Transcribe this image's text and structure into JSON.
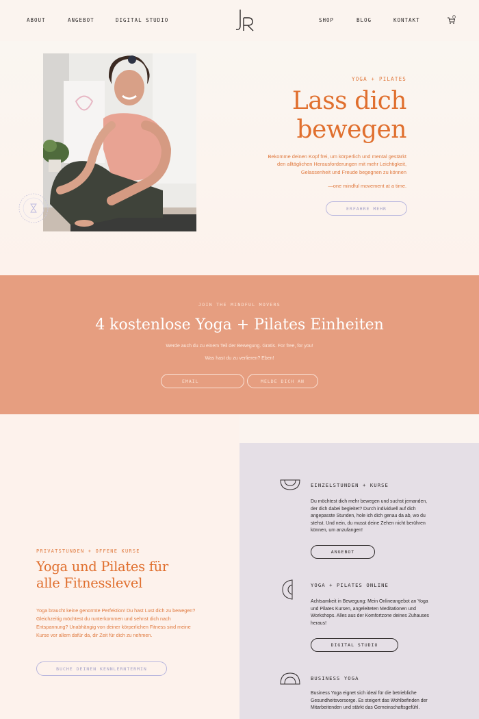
{
  "nav": {
    "left": [
      "ABOUT",
      "ANGEBOT",
      "DIGITAL STUDIO"
    ],
    "right": [
      "SHOP",
      "BLOG",
      "KONTAKT"
    ],
    "logo": "JR",
    "cart_count": "0"
  },
  "hero": {
    "eyebrow": "YOGA + PILATES",
    "title_line1": "Lass dich",
    "title_line2": "bewegen",
    "text_line1": "Bekomme deinen Kopf frei, um körperlich und mental gestärkt",
    "text_line2": "den alltäglichen Herausforderungen mit mehr Leichtigkeit,",
    "text_line3": "Gelassenheit und Freude begegnen zu können",
    "quote": "—one mindful movement at a time.",
    "button": "ERFAHRE MEHR"
  },
  "band": {
    "eyebrow": "JOIN THE MINDFUL MOVERS",
    "title": "4 kostenlose Yoga + Pilates Einheiten",
    "sub": "Werde auch du zu einem Teil der Bewegung. Gratis. For free, for you!",
    "sub2": "Was hast du zu verlieren? Eben!",
    "email_placeholder": "EMAIL",
    "button": "MELDE DICH AN"
  },
  "intro": {
    "eyebrow": "PRIVATSTUNDEN + OFFENE KURSE",
    "title_line1": "Yoga und Pilates für",
    "title_line2": "alle Fitnesslevel",
    "text": "Yoga braucht keine genormte Perfektion! Du hast Lust dich zu bewegen? Gleichzeitig möchtest du runterkommen und sehnst dich nach Entspannung? Unabhängig von deiner körperlichen Fitness sind meine Kurse vor allem dafür da, dir Zeit für dich zu nehmen.",
    "button": "BUCHE DEINEN KENNLERNTERMIN"
  },
  "services": [
    {
      "title": "EINZELSTUNDEN + KURSE",
      "text": "Du möchtest dich mehr bewegen und suchst jemanden, der dich dabei begleitet? Durch individuell auf dich angepasste Stunden, hole ich dich genau da ab, wo du stehst. Und nein, du musst deine Zehen nicht berühren können, um anzufangen!",
      "button": "ANGEBOT"
    },
    {
      "title": "YOGA + PILATES ONLINE",
      "text": "Achtsamkeit in Bewegung: Mein Onlineangebot an Yoga und Pilates Kursen, angeleiteten Meditationen und Workshops. Alles aus der Komfortzone deines Zuhauses heraus!",
      "button": "DIGITAL STUDIO"
    },
    {
      "title": "BUSINESS YOGA",
      "text": "Business Yoga eignet sich ideal für die betriebliche Gesundheitsvorsorge. Es steigert das Wohlbefinden der Mitarbeitenden und stärkt das Gemeinschaftsgefühl."
    }
  ],
  "colors": {
    "accent": "#e06f2e",
    "band": "#e69e80",
    "lavender": "#e5dfe6"
  }
}
